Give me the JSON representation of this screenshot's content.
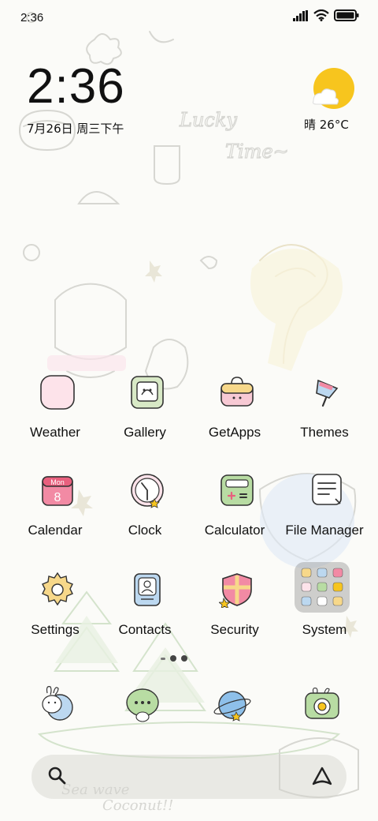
{
  "status_bar": {
    "time": "2:36",
    "signal_icon": "signal-bars-icon",
    "wifi_icon": "wifi-icon",
    "battery_icon": "battery-icon"
  },
  "clock_widget": {
    "time": "2:36",
    "date": "7月26日 周三下午"
  },
  "weather_widget": {
    "temperature": "晴 26°C",
    "icon": "sun-cloud-icon"
  },
  "apps": [
    {
      "label": "Weather",
      "icon": "weather-icon"
    },
    {
      "label": "Gallery",
      "icon": "gallery-icon"
    },
    {
      "label": "GetApps",
      "icon": "getapps-icon"
    },
    {
      "label": "Themes",
      "icon": "themes-icon"
    },
    {
      "label": "Calendar",
      "icon": "calendar-icon",
      "icon_text": "Mon",
      "icon_day": "8"
    },
    {
      "label": "Clock",
      "icon": "clock-icon"
    },
    {
      "label": "Calculator",
      "icon": "calculator-icon"
    },
    {
      "label": "File Manager",
      "icon": "file-manager-icon"
    },
    {
      "label": "Settings",
      "icon": "settings-gear-icon"
    },
    {
      "label": "Contacts",
      "icon": "contacts-icon"
    },
    {
      "label": "Security",
      "icon": "security-shield-icon"
    },
    {
      "label": "System",
      "icon": "system-folder-icon"
    }
  ],
  "page_indicator": {
    "pages": 3,
    "current": 2
  },
  "dock": [
    {
      "icon": "phone-bunny-icon"
    },
    {
      "icon": "messages-icon"
    },
    {
      "icon": "browser-planet-icon"
    },
    {
      "icon": "camera-icon"
    }
  ],
  "search_bar": {
    "search_icon": "search-icon",
    "assistant_icon": "assistant-icon"
  },
  "wallpaper_text": {
    "lucky": "Lucky",
    "time": "Time~",
    "sea": "Sea wave",
    "coconut": "Coconut!!"
  },
  "colors": {
    "accent_yellow": "#f7c51e",
    "pink": "#f5c6d4",
    "mint": "#cfe6c1",
    "sky": "#bcd8f0"
  }
}
